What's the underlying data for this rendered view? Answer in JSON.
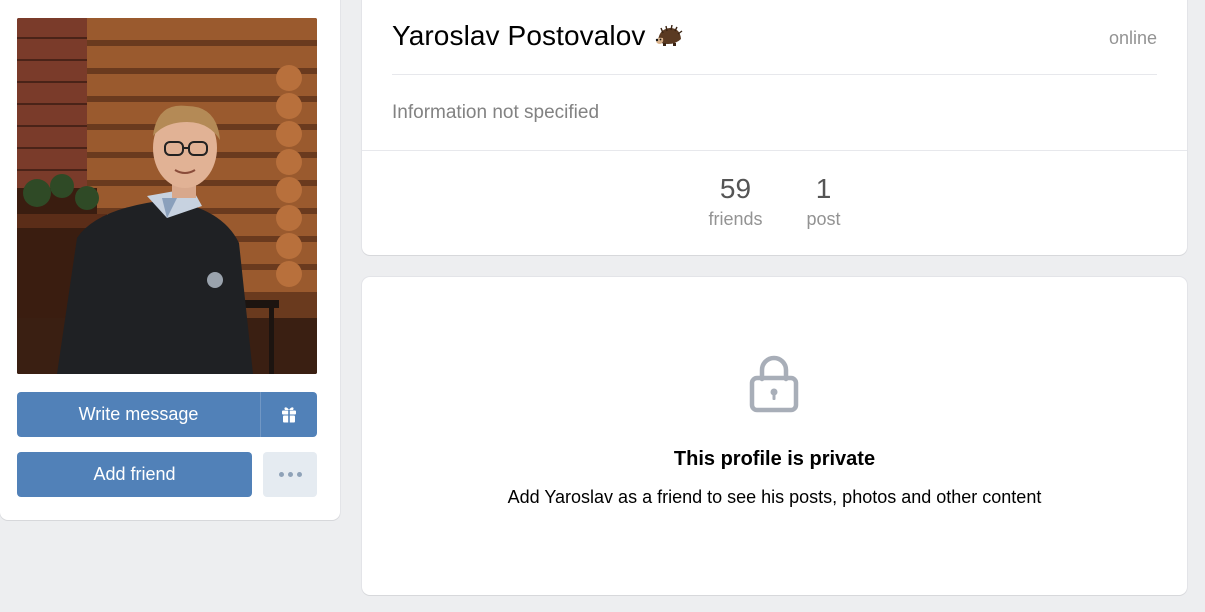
{
  "profile": {
    "name": "Yaroslav Postovalov",
    "name_emoji": "hedgehog-icon",
    "status": "online",
    "info": "Information not specified"
  },
  "actions": {
    "write_message": "Write message",
    "gift_icon": "gift-icon",
    "add_friend": "Add friend",
    "more_icon": "more-dots-icon"
  },
  "counters": [
    {
      "value": "59",
      "label": "friends"
    },
    {
      "value": "1",
      "label": "post"
    }
  ],
  "private": {
    "icon": "lock-icon",
    "title": "This profile is private",
    "subtitle": "Add Yaroslav as a friend to see his posts, photos and other content"
  },
  "colors": {
    "accent": "#5181b8",
    "background": "#edeef0",
    "secondary_button": "#e5ebf1",
    "muted_text": "#939393"
  }
}
